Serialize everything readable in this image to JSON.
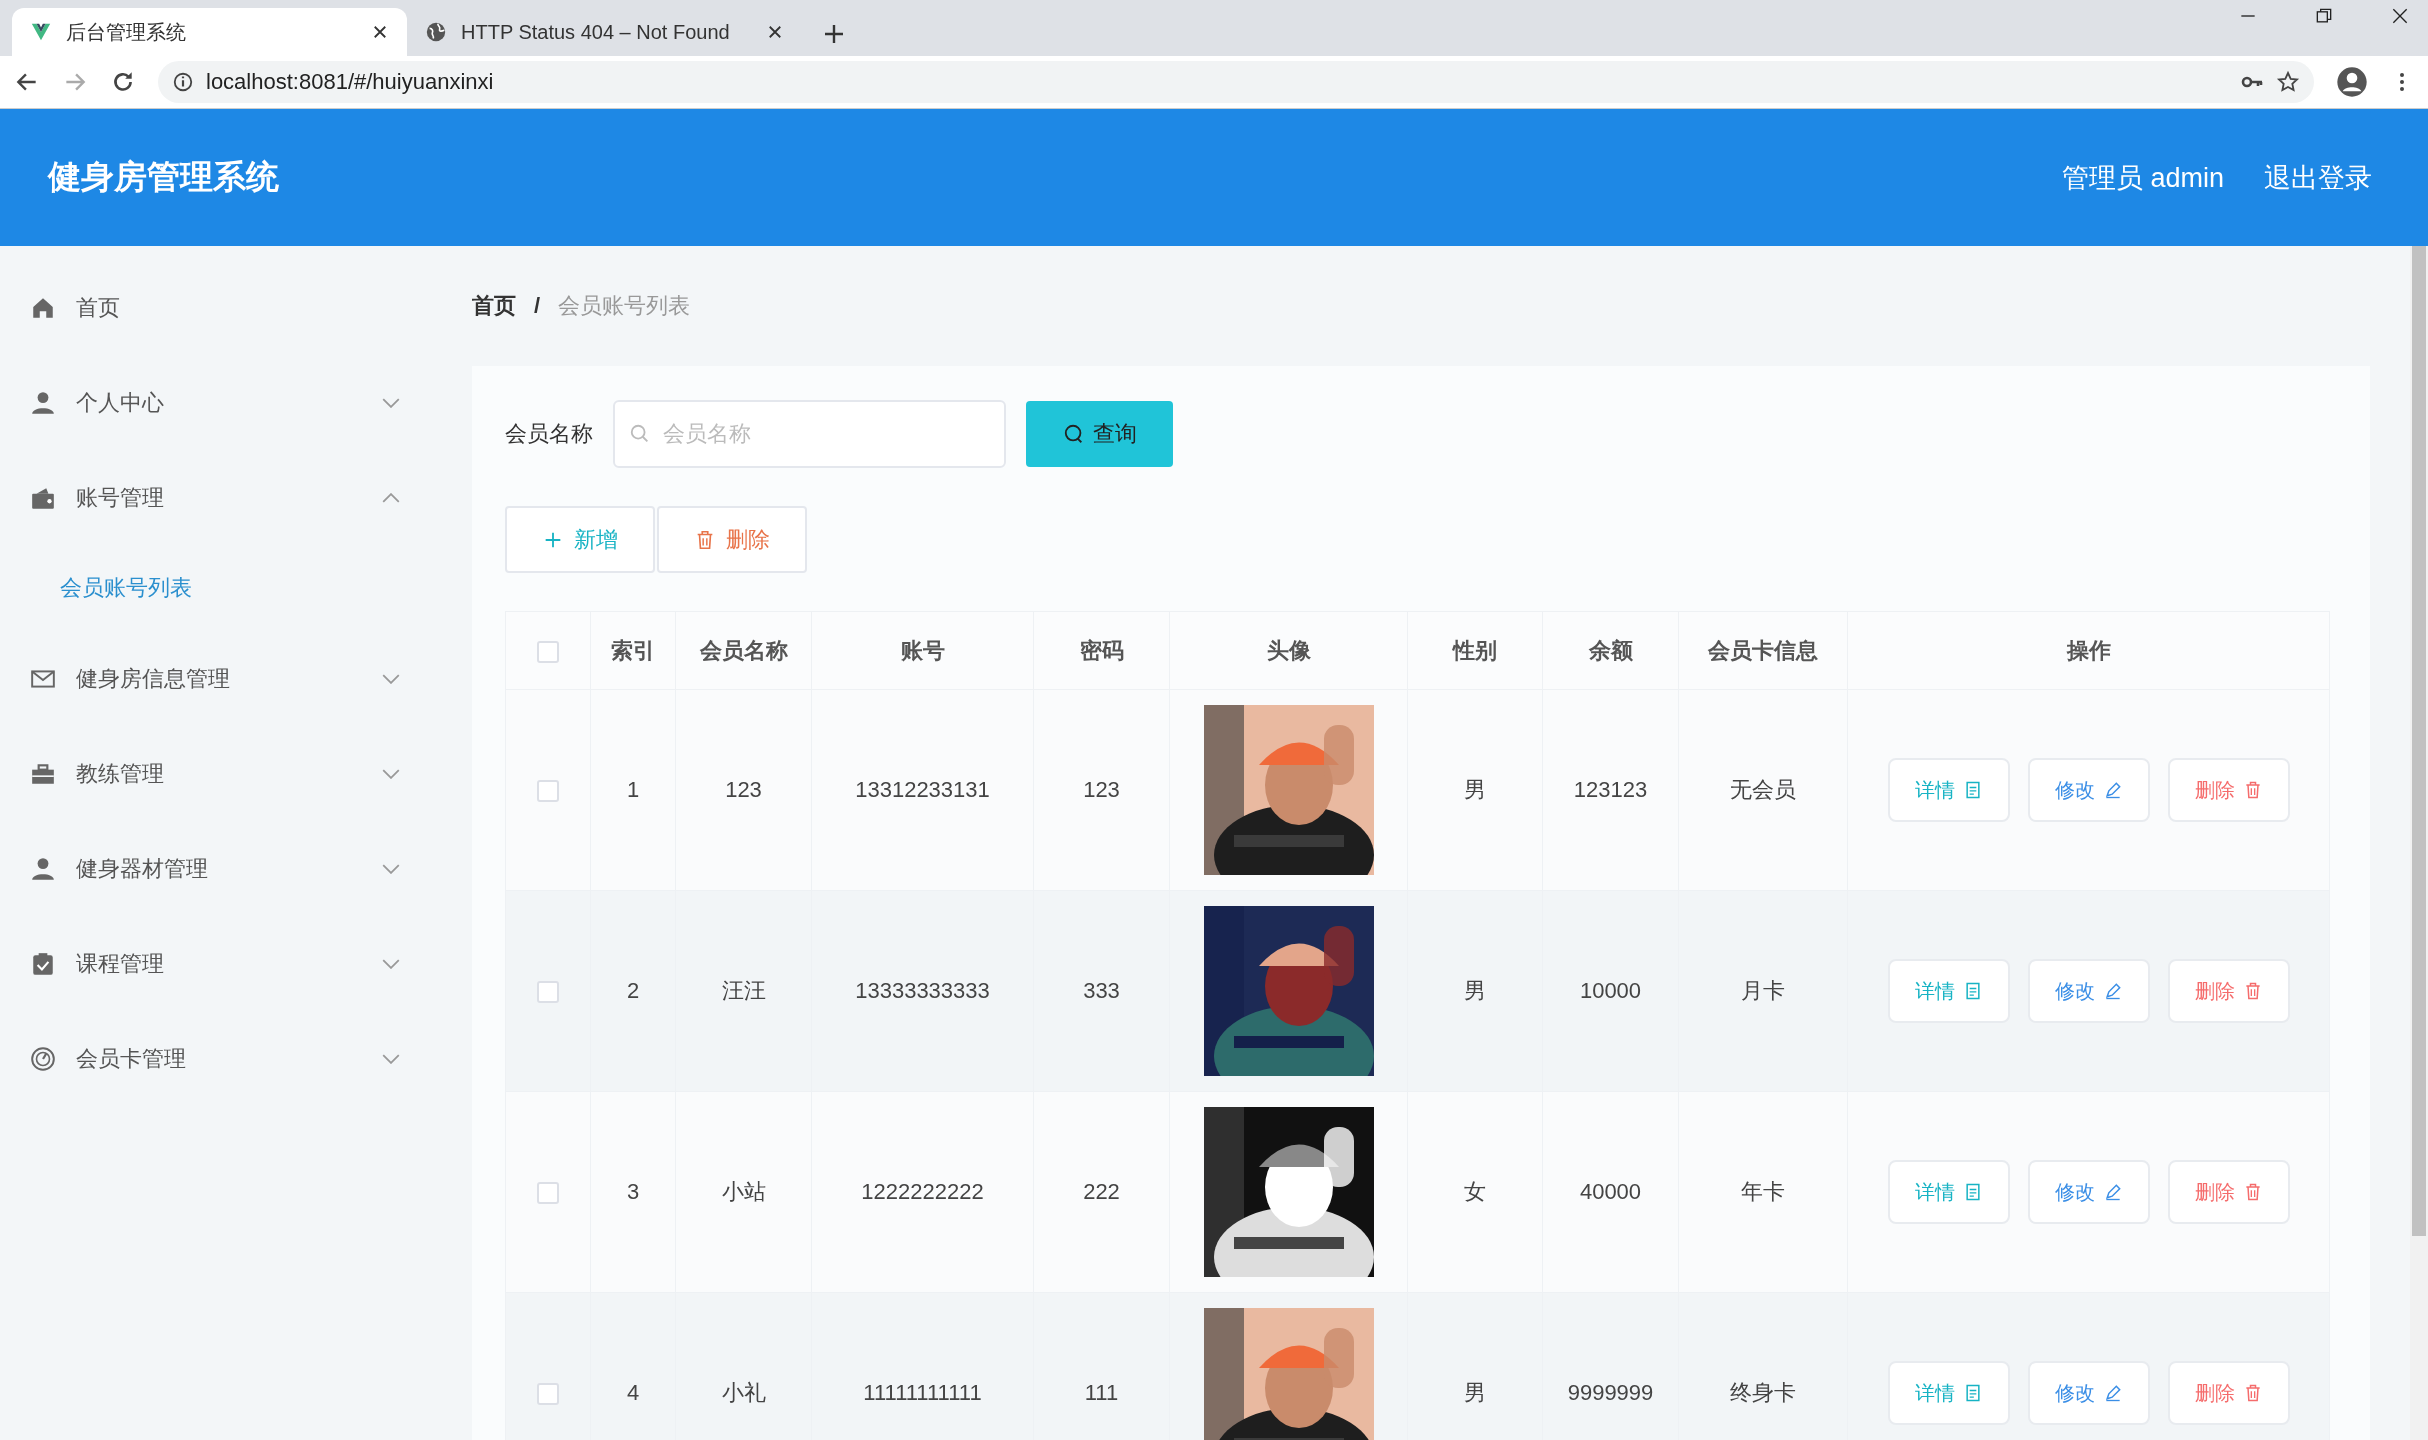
{
  "browser": {
    "tabs": [
      {
        "title": "后台管理系统",
        "selected": true
      },
      {
        "title": "HTTP Status 404 – Not Found",
        "selected": false
      }
    ],
    "url": "localhost:8081/#/huiyuanxinxi"
  },
  "header": {
    "title": "健身房管理系统",
    "user": "管理员 admin",
    "logout": "退出登录"
  },
  "sidebar": {
    "items": [
      {
        "label": "首页",
        "kind": "link"
      },
      {
        "label": "个人中心",
        "kind": "menu",
        "expanded": false
      },
      {
        "label": "账号管理",
        "kind": "menu",
        "expanded": true,
        "children": [
          {
            "label": "会员账号列表",
            "selected": true
          }
        ]
      },
      {
        "label": "健身房信息管理",
        "kind": "menu",
        "expanded": false
      },
      {
        "label": "教练管理",
        "kind": "menu",
        "expanded": false
      },
      {
        "label": "健身器材管理",
        "kind": "menu",
        "expanded": false
      },
      {
        "label": "课程管理",
        "kind": "menu",
        "expanded": false
      },
      {
        "label": "会员卡管理",
        "kind": "menu",
        "expanded": false
      }
    ]
  },
  "breadcrumb": [
    "首页",
    "会员账号列表"
  ],
  "breadcrumb_separator": "/",
  "search": {
    "label": "会员名称",
    "placeholder": "会员名称",
    "button": "查询"
  },
  "toolbar": [
    {
      "label": "新增",
      "kind": "add"
    },
    {
      "label": "删除",
      "kind": "delete"
    }
  ],
  "table": {
    "select_all": false,
    "columns": [
      "索引",
      "会员名称",
      "账号",
      "密码",
      "头像",
      "性别",
      "余额",
      "会员卡信息",
      "操作"
    ],
    "rows": [
      {
        "checked": false,
        "index": "1",
        "name": "123",
        "account": "13312233131",
        "password": "123",
        "gender": "男",
        "balance": "123123",
        "card": "无会员",
        "actions": [
          {
            "label": "详情",
            "kind": "detail"
          },
          {
            "label": "修改",
            "kind": "edit"
          },
          {
            "label": "删除",
            "kind": "delete"
          }
        ]
      },
      {
        "checked": false,
        "index": "2",
        "name": "汪汪",
        "account": "13333333333",
        "password": "333",
        "gender": "男",
        "balance": "10000",
        "card": "月卡",
        "actions": [
          {
            "label": "详情",
            "kind": "detail"
          },
          {
            "label": "修改",
            "kind": "edit"
          },
          {
            "label": "删除",
            "kind": "delete"
          }
        ]
      },
      {
        "checked": false,
        "index": "3",
        "name": "小站",
        "account": "1222222222",
        "password": "222",
        "gender": "女",
        "balance": "40000",
        "card": "年卡",
        "actions": [
          {
            "label": "详情",
            "kind": "detail"
          },
          {
            "label": "修改",
            "kind": "edit"
          },
          {
            "label": "删除",
            "kind": "delete"
          }
        ]
      },
      {
        "checked": false,
        "index": "4",
        "name": "小礼",
        "account": "11111111111",
        "password": "111",
        "gender": "男",
        "balance": "9999999",
        "card": "终身卡",
        "actions": [
          {
            "label": "详情",
            "kind": "detail"
          },
          {
            "label": "修改",
            "kind": "edit"
          },
          {
            "label": "删除",
            "kind": "delete"
          }
        ]
      }
    ]
  }
}
